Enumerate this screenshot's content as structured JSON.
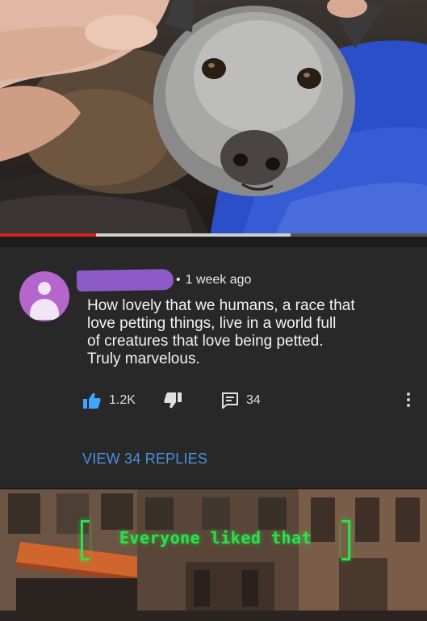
{
  "video": {
    "progress_played_fraction": 0.225,
    "progress_buffered_fraction": 0.68
  },
  "comment": {
    "username_redacted": true,
    "timestamp": "1 week ago",
    "text_lines": [
      "How lovely that we humans, a race that",
      "love petting things, live in a world full",
      "of creatures that love being petted.",
      "Truly marvelous."
    ],
    "like_count": "1.2K",
    "reply_count": "34",
    "view_replies_label": "VIEW 34 REPLIES"
  },
  "icons": {
    "like": "thumbs-up-icon",
    "dislike": "thumbs-down-icon",
    "reply": "comment-icon",
    "more": "more-vertical-icon",
    "avatar": "default-avatar-icon"
  },
  "colors": {
    "background": "#1c1c1c",
    "card": "#282828",
    "like_blue": "#3ea6ff",
    "link_blue": "#4a8fe0",
    "avatar_purple": "#b566cc",
    "redaction_purple": "#8c5bc8",
    "progress_red": "#d92020",
    "caption_green": "#23e64a"
  },
  "game_caption": {
    "text": "Everyone liked that"
  }
}
